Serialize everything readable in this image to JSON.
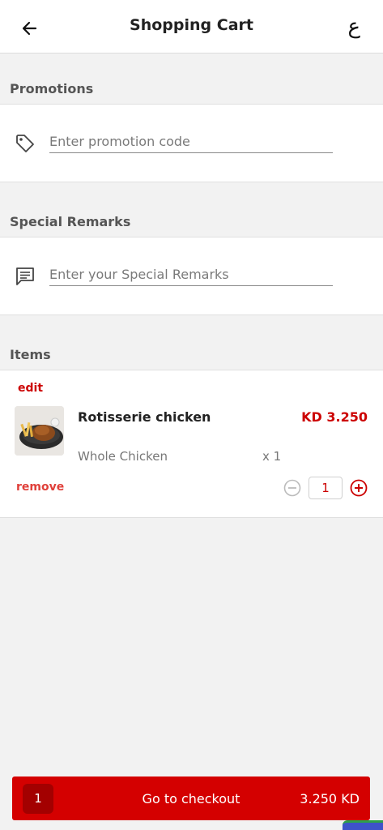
{
  "header": {
    "title": "Shopping Cart",
    "back_icon": "arrow-left-icon",
    "language_toggle": "ع"
  },
  "promotions": {
    "label": "Promotions",
    "icon": "tag-icon",
    "placeholder": "Enter promotion code",
    "value": ""
  },
  "remarks": {
    "label": "Special Remarks",
    "icon": "message-icon",
    "placeholder": "Enter your Special Remarks",
    "value": ""
  },
  "items": {
    "label": "Items",
    "list": [
      {
        "edit_label": "edit",
        "name": "Rotisserie chicken",
        "price": "KD 3.250",
        "variant": "Whole Chicken",
        "multiplier": "x 1",
        "remove_label": "remove",
        "quantity": "1"
      }
    ]
  },
  "checkout": {
    "count": "1",
    "label": "Go to checkout",
    "total": "3.250 KD"
  },
  "colors": {
    "accent": "#d40000",
    "price": "#cc0000",
    "remove": "#e0403a",
    "background": "#f2f2f2"
  }
}
